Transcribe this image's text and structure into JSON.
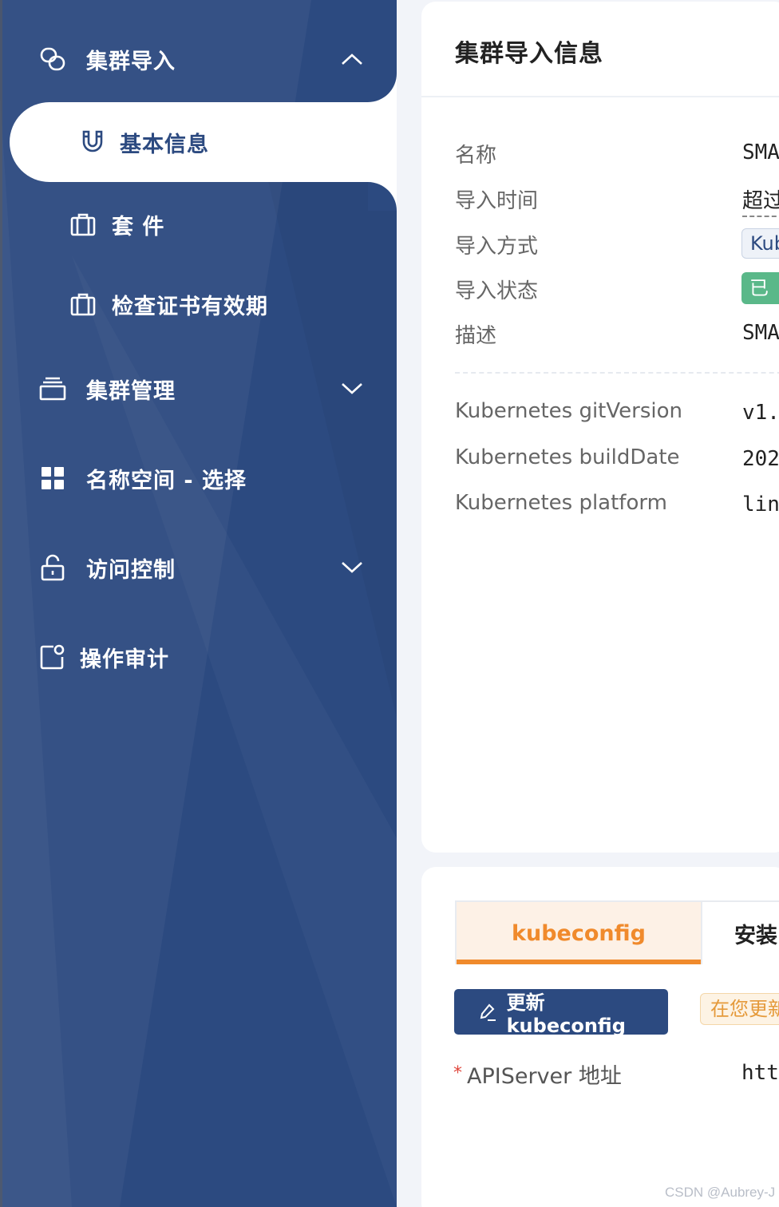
{
  "sidebar": {
    "items": [
      {
        "label": "集群导入",
        "icon": "link-icon",
        "chevron": "chevron-up-icon"
      },
      {
        "label": "基本信息",
        "icon": "magnet-icon",
        "active": true
      },
      {
        "label": "套 件",
        "icon": "toolbox-icon"
      },
      {
        "label": "检查证书有效期",
        "icon": "toolbox-icon"
      },
      {
        "label": "集群管理",
        "icon": "stack-icon",
        "chevron": "chevron-down-icon"
      },
      {
        "label": "名称空间 - 选择",
        "icon": "grid-icon"
      },
      {
        "label": "访问控制",
        "icon": "unlock-icon",
        "chevron": "chevron-down-icon"
      },
      {
        "label": "操作审计",
        "icon": "audit-icon"
      }
    ],
    "colors": {
      "background": "#2c4a80",
      "active_background": "#ffffff"
    }
  },
  "info_card": {
    "title": "集群导入信息",
    "fields": [
      {
        "label": "名称",
        "value": "SMA"
      },
      {
        "label": "导入时间",
        "value": "超过"
      },
      {
        "label": "导入方式",
        "value": "Kub"
      },
      {
        "label": "导入状态",
        "value": "已就"
      },
      {
        "label": "描述",
        "value": "SMA"
      }
    ],
    "k8s_fields": [
      {
        "label": "Kubernetes gitVersion",
        "value": "v1."
      },
      {
        "label": "Kubernetes buildDate",
        "value": "202"
      },
      {
        "label": "Kubernetes platform",
        "value": "lin"
      }
    ]
  },
  "config_card": {
    "tabs": [
      {
        "label": "kubeconfig",
        "active": true
      },
      {
        "label": "安装"
      }
    ],
    "update_button": "更新 kubeconfig",
    "warning": "在您更新",
    "apiserver_label": "APIServer 地址",
    "required_mark": "*",
    "apiserver_value": "htt"
  },
  "watermark": "CSDN @Aubrey-J",
  "colors": {
    "accent": "#f08a2c",
    "primary": "#2c4a80",
    "success": "#5ab889",
    "danger": "#e0463c"
  }
}
